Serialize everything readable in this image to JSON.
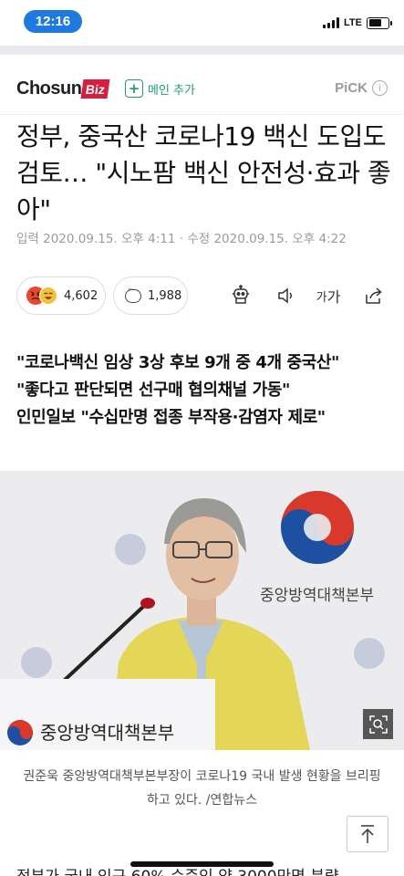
{
  "status_bar": {
    "time": "12:16",
    "network": "LTE",
    "battery_level": 0.72
  },
  "header": {
    "logo_text": "Chosun",
    "logo_badge": "Biz",
    "add_main_label": "메인 추가",
    "pick_label": "PiCK",
    "pick_info_glyph": "i"
  },
  "article": {
    "headline": "정부, 중국산 코로나19 백신 도입도 검토… \"시노팜 백신 안전성·효과 좋아\"",
    "dateline": "입력 2020.09.15. 오후 4:11 · 수정 2020.09.15. 오후 4:22",
    "reactions_count": "4,602",
    "comments_count": "1,988",
    "font_size_label_small": "가",
    "font_size_label_large": "가",
    "subtitles": [
      "\"코로나백신 임상 3상 후보 9개 중 4개 중국산\"",
      "\"좋다고 판단되면 선구매 협의채널 가동\"",
      "인민일보 \"수십만명 접종 부작용·감염자 제로\""
    ],
    "photo_sign_text": "중앙방역대책본부",
    "photo_podium_text": "중앙방역대책본부",
    "caption": "권준욱 중앙방역대책부본부장이 코로나19 국내 발생 현황을 브리핑 하고 있다. /연합뉴스",
    "next_paragraph_partial": "정부가 국내 인구 60% 수준인 약 3000만명 분량"
  },
  "icons": {
    "reaction_icons": [
      "angry-emoji-icon",
      "laugh-emoji-icon"
    ],
    "comment": "speech-bubble-icon",
    "robot": "robot-reader-icon",
    "speaker": "speaker-icon",
    "share": "share-icon",
    "zoom": "zoom-expand-icon",
    "top": "arrow-up-icon"
  },
  "colors": {
    "time_pill": "#1f7ae0",
    "logo_badge": "#d41f3f",
    "add_main": "#20a06a",
    "vest": "#e8d85a"
  }
}
